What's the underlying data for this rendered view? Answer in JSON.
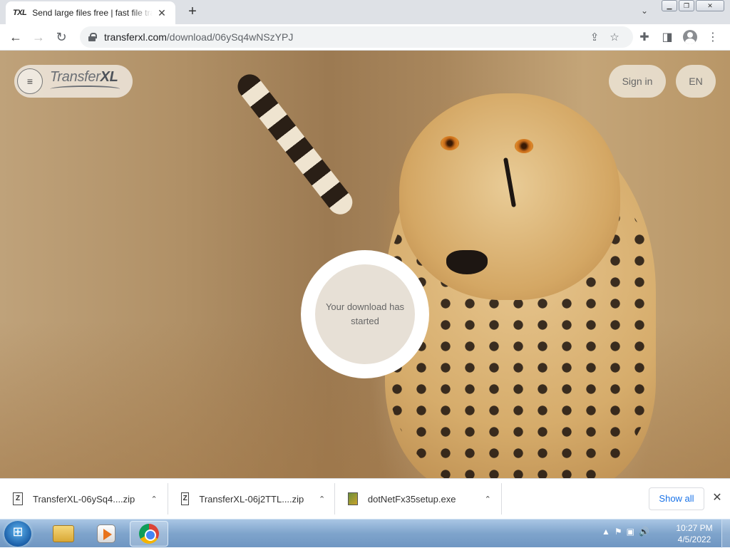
{
  "browser": {
    "tab": {
      "favicon": "TXL",
      "title": "Send large files free | fast file transfer",
      "close": "✕"
    },
    "new_tab": "+",
    "tab_search": "⌄",
    "window_controls": {
      "minimize": "▁",
      "maximize": "❐",
      "close": "✕"
    },
    "url": {
      "host": "transferxl.com",
      "path": "/download/06ySq4wNSzYPJ"
    }
  },
  "site": {
    "menu_icon": "≡",
    "logo": {
      "light": "Transfer",
      "bold": "XL"
    },
    "signin_label": "Sign in",
    "language_label": "EN",
    "download_status": "Your download has started"
  },
  "downloads": {
    "items": [
      {
        "name": "TransferXL-06ySq4....zip",
        "icon": "zip-icon"
      },
      {
        "name": "TransferXL-06j2TTL....zip",
        "icon": "zip-icon"
      },
      {
        "name": "dotNetFx35setup.exe",
        "icon": "exe-icon"
      }
    ],
    "show_all_label": "Show all",
    "close": "✕"
  },
  "taskbar": {
    "clock_time": "10:27 PM",
    "clock_date": "4/5/2022",
    "tray_icons": [
      "▲",
      "⚑",
      "▣",
      "🔊"
    ]
  }
}
